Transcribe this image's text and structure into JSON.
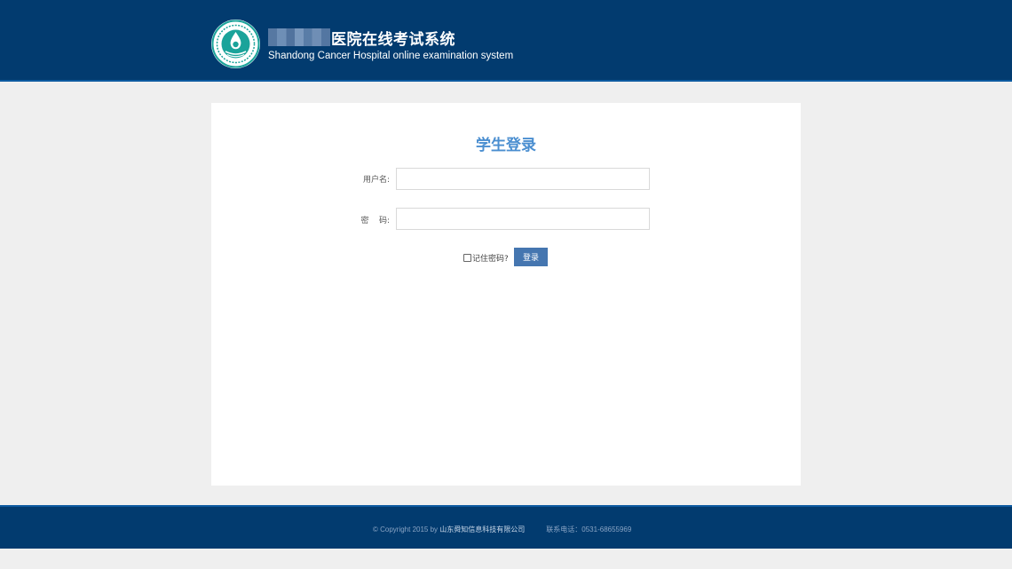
{
  "header": {
    "title_cn": "医院在线考试系统",
    "title_en": "Shandong Cancer Hospital online examination system"
  },
  "login": {
    "title": "学生登录",
    "username_label": "用户名:",
    "username_value": "",
    "password_label": "密    码:",
    "password_value": "",
    "remember_label": "记住密码?",
    "remember_checked": false,
    "submit_label": "登录"
  },
  "footer": {
    "copyright": "© Copyright 2015 by ",
    "company": "山东舜知信息科技有限公司",
    "contact": "联系电话：0531-68655969"
  },
  "colors": {
    "header_bg": "#023b6f",
    "accent_title": "#4a8ed0",
    "button_bg": "#4576b0",
    "page_bg": "#efefef"
  },
  "icons": {
    "logo": "hospital-logo-icon",
    "checkbox": "checkbox-icon"
  }
}
